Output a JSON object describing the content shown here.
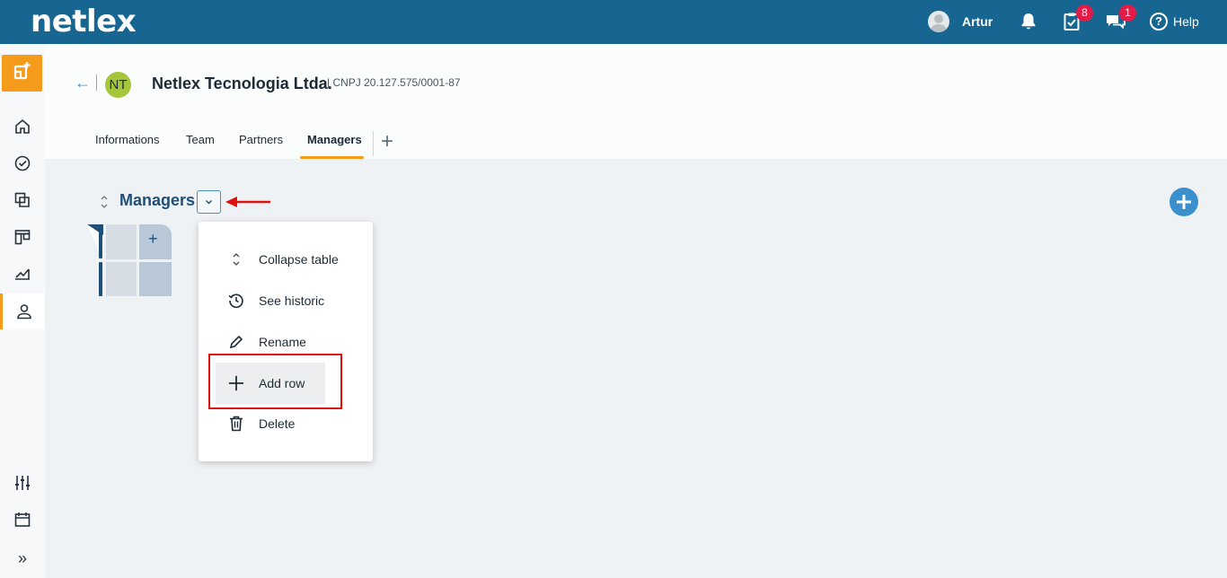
{
  "app": {
    "logo_text": "netlex",
    "brand_color": "#176591",
    "accent_color": "#f49b1c"
  },
  "topbar": {
    "user_name": "Artur",
    "tasks_badge": "8",
    "chat_badge": "1",
    "help_label": "Help",
    "help_glyph": "?"
  },
  "sidebar": {
    "items": [
      "home-icon",
      "activity-icon",
      "documents-icon",
      "kanban-icon",
      "chart-icon",
      "contacts-icon"
    ],
    "bottom": [
      "settings-sliders-icon",
      "calendar-icon",
      "expand-icon"
    ],
    "expand_glyph": "»"
  },
  "header": {
    "back_glyph": "←",
    "company_initials": "NT",
    "company_name": "Netlex Tecnologia Ltda.",
    "cnpj": "| CNPJ 20.127.575/0001-87",
    "tabs": [
      {
        "label": "Informations",
        "active": false
      },
      {
        "label": "Team",
        "active": false
      },
      {
        "label": "Partners",
        "active": false
      },
      {
        "label": "Managers",
        "active": true
      }
    ],
    "add_tab_glyph": "+"
  },
  "section": {
    "title": "Managers",
    "table_add_glyph": "+"
  },
  "menu": {
    "items": [
      {
        "label": "Collapse table",
        "icon": "collapse-icon"
      },
      {
        "label": "See historic",
        "icon": "history-icon"
      },
      {
        "label": "Rename",
        "icon": "pencil-icon"
      },
      {
        "label": "Add row",
        "icon": "plus-icon",
        "highlighted": true
      },
      {
        "label": "Delete",
        "icon": "trash-icon"
      }
    ]
  }
}
